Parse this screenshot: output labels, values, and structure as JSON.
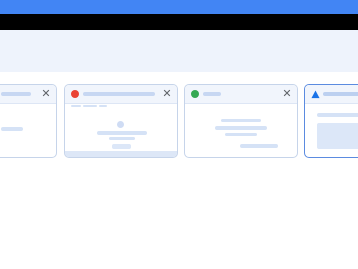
{
  "browser": {
    "accent_color": "#4285f4",
    "frame_color": "#000000",
    "header_bg": "#eef3fc"
  },
  "tabs": [
    {
      "favicon": "none",
      "close_symbol": "✕",
      "selected": false
    },
    {
      "favicon": "red-dot-icon",
      "favicon_color": "#ea4335",
      "close_symbol": "✕",
      "selected": false
    },
    {
      "favicon": "green-dot-icon",
      "favicon_color": "#34a853",
      "close_symbol": "✕",
      "selected": false
    },
    {
      "favicon": "triangle-icon",
      "favicon_color": "#1a73e8",
      "close_symbol": "",
      "selected": true
    }
  ]
}
